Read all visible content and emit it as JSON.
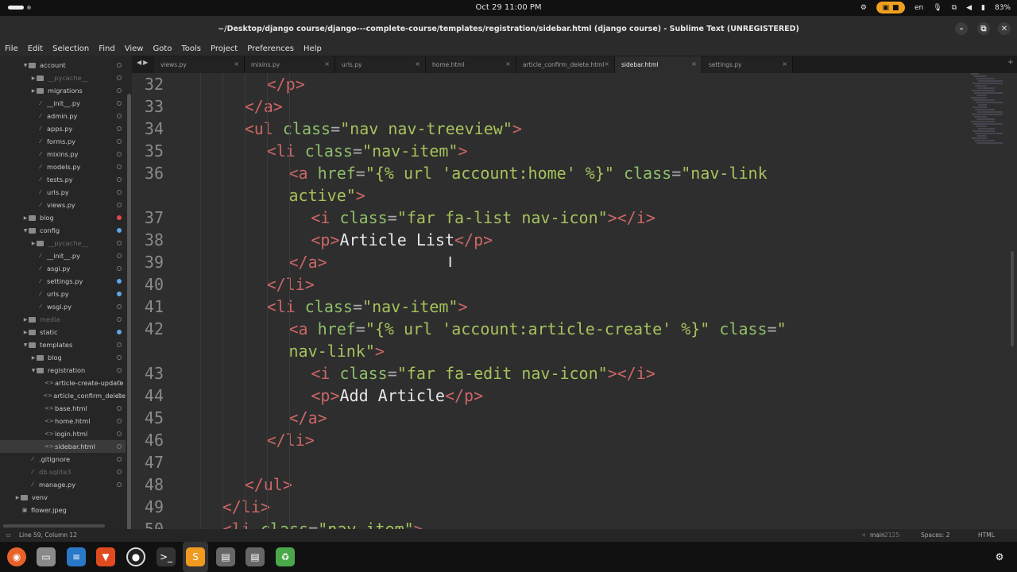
{
  "topbar": {
    "clock": "Oct 29  11:00 PM",
    "language": "en",
    "battery": "83%"
  },
  "window": {
    "title": "~/Desktop/django course/django---complete-course/templates/registration/sidebar.html (django course) - Sublime Text (UNREGISTERED)"
  },
  "menu": [
    "File",
    "Edit",
    "Selection",
    "Find",
    "View",
    "Goto",
    "Tools",
    "Project",
    "Preferences",
    "Help"
  ],
  "sidebar": {
    "items": [
      {
        "label": "account",
        "type": "folder",
        "open": true,
        "depth": 1
      },
      {
        "label": "__pycache__",
        "type": "folder",
        "open": false,
        "depth": 2,
        "dim": true
      },
      {
        "label": "migrations",
        "type": "folder",
        "open": false,
        "depth": 2
      },
      {
        "label": "__init__.py",
        "type": "file",
        "depth": 2
      },
      {
        "label": "admin.py",
        "type": "file",
        "depth": 2
      },
      {
        "label": "apps.py",
        "type": "file",
        "depth": 2
      },
      {
        "label": "forms.py",
        "type": "file",
        "depth": 2
      },
      {
        "label": "mixins.py",
        "type": "file",
        "depth": 2
      },
      {
        "label": "models.py",
        "type": "file",
        "depth": 2
      },
      {
        "label": "tests.py",
        "type": "file",
        "depth": 2
      },
      {
        "label": "urls.py",
        "type": "file",
        "depth": 2
      },
      {
        "label": "views.py",
        "type": "file",
        "depth": 2
      },
      {
        "label": "blog",
        "type": "folder",
        "open": false,
        "depth": 1,
        "mark": "red"
      },
      {
        "label": "config",
        "type": "folder",
        "open": true,
        "depth": 1,
        "mark": "blue"
      },
      {
        "label": "__pycache__",
        "type": "folder",
        "open": false,
        "depth": 2,
        "dim": true
      },
      {
        "label": "__init__.py",
        "type": "file",
        "depth": 2
      },
      {
        "label": "asgi.py",
        "type": "file",
        "depth": 2
      },
      {
        "label": "settings.py",
        "type": "file",
        "depth": 2,
        "mark": "blue"
      },
      {
        "label": "urls.py",
        "type": "file",
        "depth": 2,
        "mark": "blue"
      },
      {
        "label": "wsgi.py",
        "type": "file",
        "depth": 2
      },
      {
        "label": "media",
        "type": "folder",
        "open": false,
        "depth": 1,
        "dim": true
      },
      {
        "label": "static",
        "type": "folder",
        "open": false,
        "depth": 1,
        "mark": "blue"
      },
      {
        "label": "templates",
        "type": "folder",
        "open": true,
        "depth": 1
      },
      {
        "label": "blog",
        "type": "folder",
        "open": false,
        "depth": 2
      },
      {
        "label": "registration",
        "type": "folder",
        "open": true,
        "depth": 2
      },
      {
        "label": "article-create-update",
        "type": "html",
        "depth": 3
      },
      {
        "label": "article_confirm_delete",
        "type": "html",
        "depth": 3
      },
      {
        "label": "base.html",
        "type": "html",
        "depth": 3
      },
      {
        "label": "home.html",
        "type": "html",
        "depth": 3
      },
      {
        "label": "login.html",
        "type": "html",
        "depth": 3
      },
      {
        "label": "sidebar.html",
        "type": "html",
        "depth": 3,
        "selected": true
      },
      {
        "label": ".gitignore",
        "type": "file",
        "depth": 1
      },
      {
        "label": "db.sqlite3",
        "type": "file",
        "depth": 1,
        "dim": true
      },
      {
        "label": "manage.py",
        "type": "file",
        "depth": 1
      },
      {
        "label": "venv",
        "type": "folder",
        "open": false,
        "depth": 0
      },
      {
        "label": "flower.jpeg",
        "type": "image",
        "depth": 0
      }
    ]
  },
  "tabs": [
    {
      "label": "views.py",
      "active": false
    },
    {
      "label": "mixins.py",
      "active": false
    },
    {
      "label": "urls.py",
      "active": false
    },
    {
      "label": "home.html",
      "active": false
    },
    {
      "label": "article_confirm_delete.html",
      "active": false
    },
    {
      "label": "sidebar.html",
      "active": true
    },
    {
      "label": "settings.py",
      "active": false
    }
  ],
  "editor": {
    "lines": [
      {
        "n": "32",
        "indent": 8,
        "tokens": [
          [
            "tg",
            "</p>"
          ]
        ]
      },
      {
        "n": "33",
        "indent": 6,
        "tokens": [
          [
            "tg",
            "</a>"
          ]
        ]
      },
      {
        "n": "34",
        "indent": 6,
        "tokens": [
          [
            "tg",
            "<ul "
          ],
          [
            "at",
            "class"
          ],
          [
            "pt",
            "="
          ],
          [
            "st",
            "\"nav nav-treeview\""
          ],
          [
            "tg",
            ">"
          ]
        ]
      },
      {
        "n": "35",
        "indent": 8,
        "tokens": [
          [
            "tg",
            "<li "
          ],
          [
            "at",
            "class"
          ],
          [
            "pt",
            "="
          ],
          [
            "st",
            "\"nav-item\""
          ],
          [
            "tg",
            ">"
          ]
        ]
      },
      {
        "n": "36",
        "indent": 10,
        "tokens": [
          [
            "tg",
            "<a "
          ],
          [
            "at",
            "href"
          ],
          [
            "pt",
            "="
          ],
          [
            "st",
            "\"{% url 'account:home' %}\""
          ],
          [
            "tx",
            " "
          ],
          [
            "at",
            "class"
          ],
          [
            "pt",
            "="
          ],
          [
            "st",
            "\"nav-link"
          ]
        ]
      },
      {
        "n": "",
        "indent": 10,
        "tokens": [
          [
            "st",
            "active\""
          ],
          [
            "tg",
            ">"
          ]
        ]
      },
      {
        "n": "37",
        "indent": 12,
        "tokens": [
          [
            "tg",
            "<i "
          ],
          [
            "at",
            "class"
          ],
          [
            "pt",
            "="
          ],
          [
            "st",
            "\"far fa-list nav-icon\""
          ],
          [
            "tg",
            "></i>"
          ]
        ]
      },
      {
        "n": "38",
        "indent": 12,
        "tokens": [
          [
            "tg",
            "<p>"
          ],
          [
            "tx",
            "Article List"
          ],
          [
            "tg",
            "</p>"
          ]
        ]
      },
      {
        "n": "39",
        "indent": 10,
        "tokens": [
          [
            "tg",
            "</a>"
          ]
        ]
      },
      {
        "n": "40",
        "indent": 8,
        "tokens": [
          [
            "tg",
            "</li>"
          ]
        ]
      },
      {
        "n": "41",
        "indent": 8,
        "tokens": [
          [
            "tg",
            "<li "
          ],
          [
            "at",
            "class"
          ],
          [
            "pt",
            "="
          ],
          [
            "st",
            "\"nav-item\""
          ],
          [
            "tg",
            ">"
          ]
        ]
      },
      {
        "n": "42",
        "indent": 10,
        "tokens": [
          [
            "tg",
            "<a "
          ],
          [
            "at",
            "href"
          ],
          [
            "pt",
            "="
          ],
          [
            "st",
            "\"{% url 'account:article-create' %}\""
          ],
          [
            "tx",
            " "
          ],
          [
            "at",
            "class"
          ],
          [
            "pt",
            "="
          ],
          [
            "st",
            "\""
          ]
        ]
      },
      {
        "n": "",
        "indent": 10,
        "tokens": [
          [
            "st",
            "nav-link\""
          ],
          [
            "tg",
            ">"
          ]
        ]
      },
      {
        "n": "43",
        "indent": 12,
        "tokens": [
          [
            "tg",
            "<i "
          ],
          [
            "at",
            "class"
          ],
          [
            "pt",
            "="
          ],
          [
            "st",
            "\"far fa-edit nav-icon\""
          ],
          [
            "tg",
            "></i>"
          ]
        ]
      },
      {
        "n": "44",
        "indent": 12,
        "tokens": [
          [
            "tg",
            "<p>"
          ],
          [
            "tx",
            "Add Article"
          ],
          [
            "tg",
            "</p>"
          ]
        ]
      },
      {
        "n": "45",
        "indent": 10,
        "tokens": [
          [
            "tg",
            "</a>"
          ]
        ]
      },
      {
        "n": "46",
        "indent": 8,
        "tokens": [
          [
            "tg",
            "</li>"
          ]
        ]
      },
      {
        "n": "47",
        "indent": 0,
        "tokens": []
      },
      {
        "n": "48",
        "indent": 6,
        "tokens": [
          [
            "tg",
            "</ul>"
          ]
        ]
      },
      {
        "n": "49",
        "indent": 4,
        "tokens": [
          [
            "tg",
            "</li>"
          ]
        ]
      },
      {
        "n": "50",
        "indent": 4,
        "tokens": [
          [
            "tg",
            "<li "
          ],
          [
            "at",
            "class"
          ],
          [
            "pt",
            "="
          ],
          [
            "st",
            "\"nav-item\""
          ],
          [
            "tg",
            ">"
          ]
        ]
      }
    ]
  },
  "statusbar": {
    "position": "Line 59, Column 12",
    "branch": "main",
    "branch_count": "2125",
    "spaces": "Spaces: 2",
    "syntax": "HTML"
  },
  "colors": {
    "accent": "#f0a020",
    "tag": "#cc6666",
    "attr": "#8fbf6a",
    "string": "#a5c25c"
  },
  "dock": [
    "firefox-icon",
    "files-icon",
    "writer-icon",
    "brave-icon",
    "obs-icon",
    "terminal-icon",
    "sublime-icon",
    "ssd-icon",
    "ssd-icon",
    "trash-icon",
    "apps-icon"
  ]
}
